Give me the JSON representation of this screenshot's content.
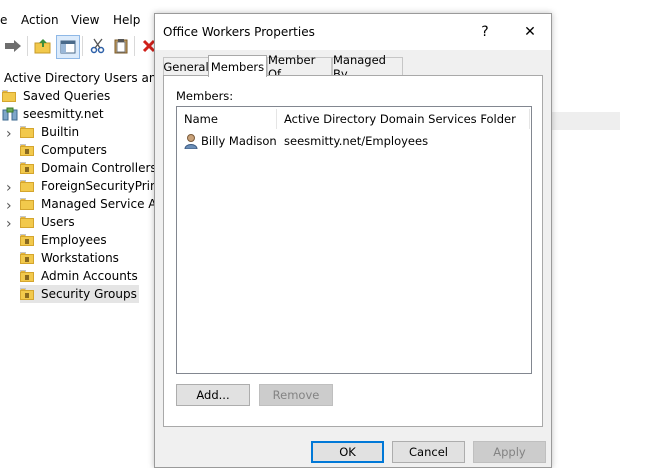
{
  "menu": {
    "file_fragment": "e",
    "action": "Action",
    "view": "View",
    "help": "Help"
  },
  "toolbar": {
    "icons": [
      "back-arrow-icon",
      "up-folder-icon",
      "show-tree-icon",
      "cut-icon",
      "paste-icon",
      "delete-icon"
    ]
  },
  "tree": {
    "root": "Active Directory Users and C",
    "saved_queries": "Saved Queries",
    "domain": "seesmitty.net",
    "items": [
      {
        "label": "Builtin",
        "expander": true
      },
      {
        "label": "Computers",
        "expander": false
      },
      {
        "label": "Domain Controllers",
        "expander": false
      },
      {
        "label": "ForeignSecurityPrinci",
        "expander": true
      },
      {
        "label": "Managed Service Acc",
        "expander": true
      },
      {
        "label": "Users",
        "expander": true
      },
      {
        "label": "Employees",
        "expander": false
      },
      {
        "label": "Workstations",
        "expander": false
      },
      {
        "label": "Admin Accounts",
        "expander": false
      },
      {
        "label": "Security Groups",
        "expander": false,
        "selected": true
      }
    ]
  },
  "dialog": {
    "title": "Office Workers Properties",
    "help_glyph": "?",
    "close_glyph": "✕",
    "tabs": [
      "General",
      "Members",
      "Member Of",
      "Managed By"
    ],
    "active_tab": "Members",
    "members_label": "Members:",
    "columns": [
      "Name",
      "Active Directory Domain Services Folder"
    ],
    "rows": [
      {
        "name": "Billy Madison",
        "folder": "seesmitty.net/Employees"
      }
    ],
    "add_button": "Add...",
    "remove_button": "Remove",
    "ok_button": "OK",
    "cancel_button": "Cancel",
    "apply_button": "Apply"
  },
  "colors": {
    "accent": "#0078d7",
    "folder": "#f2c94c",
    "selection": "#e5e5e5"
  }
}
